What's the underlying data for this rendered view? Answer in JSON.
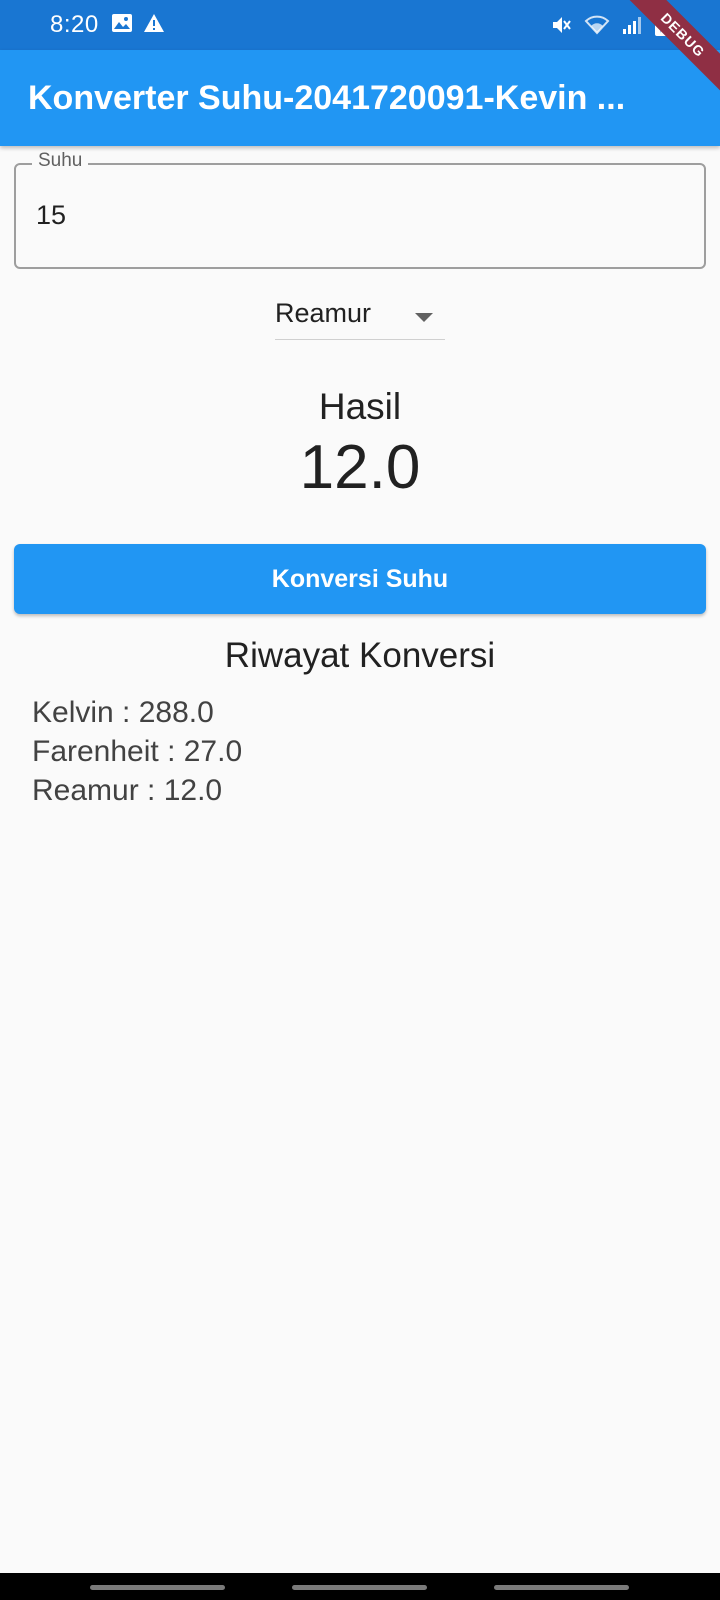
{
  "status_bar": {
    "time": "8:20",
    "left_icons": [
      "image-icon",
      "warning-icon"
    ],
    "right_icons": [
      "mute-icon",
      "wifi-icon",
      "signal-icon",
      "battery-charging-icon"
    ]
  },
  "debug_banner": "DEBUG",
  "app_bar": {
    "title": "Konverter Suhu-2041720091-Kevin ..."
  },
  "temperature_field": {
    "label": "Suhu",
    "value": "15"
  },
  "unit_dropdown": {
    "selected": "Reamur",
    "icon": "arrow-drop-down-icon"
  },
  "result": {
    "label": "Hasil",
    "value": "12.0"
  },
  "convert_button": {
    "label": "Konversi Suhu"
  },
  "history": {
    "title": "Riwayat Konversi",
    "items": [
      "Kelvin : 288.0",
      "Farenheit : 27.0",
      "Reamur : 12.0"
    ]
  },
  "colors": {
    "primary": "#2196f3",
    "status_bar": "#1976d2",
    "debug_ribbon": "#8f2f44",
    "background": "#fafafa"
  }
}
